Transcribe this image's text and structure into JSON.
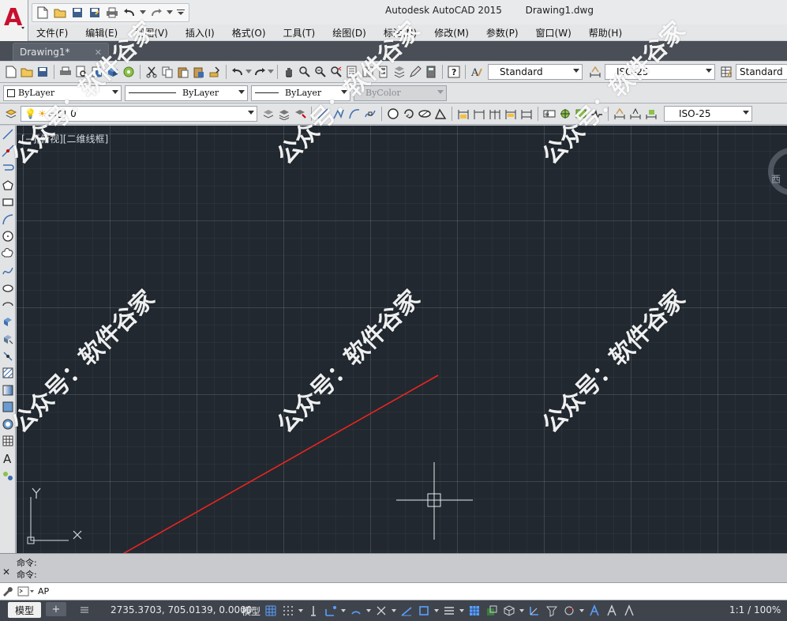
{
  "app": {
    "title": "Autodesk AutoCAD 2015",
    "document": "Drawing1.dwg",
    "logo_letter": "A",
    "brand_color": "#c8102e"
  },
  "menu": [
    "文件(F)",
    "编辑(E)",
    "视图(V)",
    "插入(I)",
    "格式(O)",
    "工具(T)",
    "绘图(D)",
    "标注(N)",
    "修改(M)",
    "参数(P)",
    "窗口(W)",
    "帮助(H)"
  ],
  "tabs": {
    "active": "Drawing1*",
    "close": "✕"
  },
  "toolbar": {
    "text_style": "Standard",
    "dim_style": "ISO-25",
    "table_style": "Standard",
    "color": "ByLayer",
    "linetype": "ByLayer",
    "lineweight": "ByLayer",
    "plotstyle": "ByColor",
    "layer": "0",
    "dim_style2": "ISO-25"
  },
  "viewport": {
    "label": "[−][俯视][二维线框]",
    "viewcube_face": "西",
    "ucs_x": "X",
    "ucs_y": "Y",
    "watermark": "公众号：软件谷家"
  },
  "command": {
    "close": "✕",
    "history": [
      "命令:",
      "命令:"
    ],
    "input": "AP"
  },
  "annotation": {
    "arrow_color": "#e8251f"
  },
  "status": {
    "model_tab": "模型",
    "add_tab": "+",
    "coords": "2735.3703, 705.0139, 0.0000",
    "space": "模型",
    "scale": "1:1 / 100%"
  }
}
